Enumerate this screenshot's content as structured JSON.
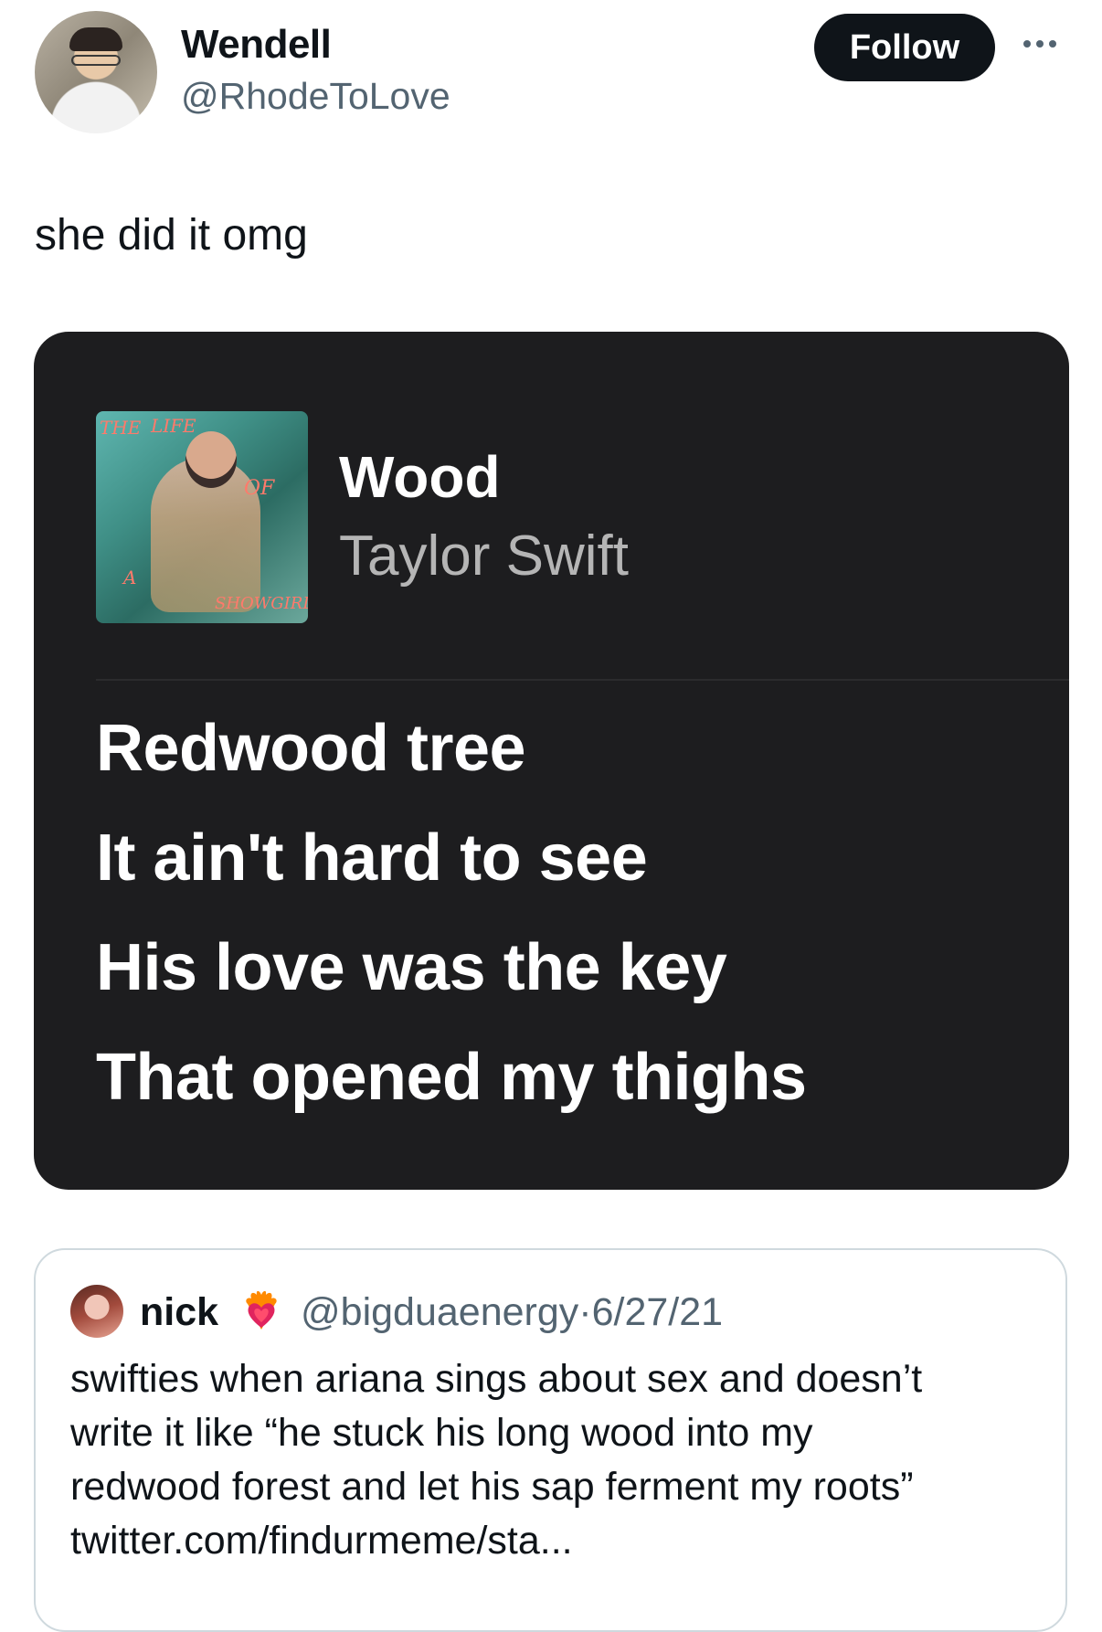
{
  "tweet": {
    "author": {
      "name": "Wendell",
      "handle": "@RhodeToLove"
    },
    "follow_label": "Follow",
    "more_icon": "more-horizontal-icon",
    "text": "she did it omg"
  },
  "lyrics_card": {
    "album_cover_text": {
      "the": "THE",
      "life": "LIFE",
      "of": "OF",
      "a": "A",
      "showgirl": "SHOWGIRL"
    },
    "song_title": "Wood",
    "artist": "Taylor Swift",
    "lines": [
      "Redwood tree",
      "It ain't hard to see",
      "His love was the key",
      "That opened my thighs"
    ]
  },
  "quoted_tweet": {
    "name": "nick",
    "badge_icon": "heart-on-fire-icon",
    "handle": "@bigduaenergy",
    "separator": "·",
    "date": "6/27/21",
    "text_lines": [
      "swifties when ariana sings about sex and doesn’t",
      "write it like “he stuck his long wood into my",
      "redwood forest and let his sap ferment my roots”",
      "twitter.com/findurmeme/sta..."
    ]
  },
  "colors": {
    "text": "#0f1419",
    "secondary": "#536471",
    "card_bg": "#1d1d1f",
    "follow_bg": "#0f1419",
    "border": "#cfd9de"
  }
}
